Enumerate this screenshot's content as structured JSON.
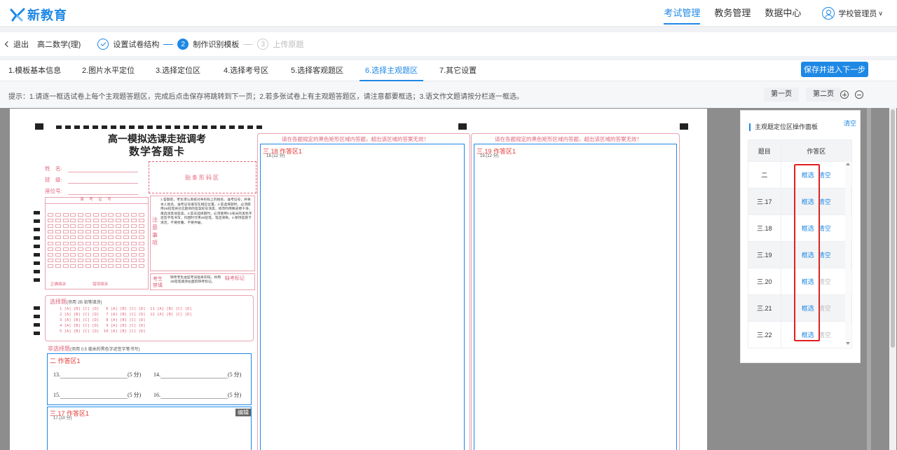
{
  "header": {
    "logo_text": "新教育",
    "nav": [
      "考试管理",
      "教务管理",
      "数据中心"
    ],
    "user": "学校管理员"
  },
  "stepbar": {
    "back": "退出",
    "course": "高二数学(理)",
    "steps": [
      {
        "num": "1",
        "label": "设置试卷结构"
      },
      {
        "num": "2",
        "label": "制作识别模板"
      },
      {
        "num": "3",
        "label": "上传原题"
      }
    ]
  },
  "tabs": [
    "1.模板基本信息",
    "2.图片水平定位",
    "3.选择定位区",
    "4.选择考号区",
    "5.选择客观题区",
    "6.选择主观题区",
    "7.其它设置"
  ],
  "save_button": "保存并进入下一步",
  "tips": "提示：1.请逐一框选试卷上每个主观题答题区，完成后点击保存将跳转到下一页；2.若多张试卷上有主观题答题区，请注意都要框选；3.语文作文题请按分栏逐一框选。",
  "pager": {
    "prev": "第一页",
    "next": "第二页"
  },
  "sheet": {
    "title1": "高一模拟选课走班调考",
    "title2": "数学答题卡",
    "info": [
      "姓　名:",
      "班　级:",
      "座位号:"
    ],
    "barcode": "贴条形码区",
    "exam_no": "准 考 证 号",
    "notice_title": "注意事项",
    "notice_text": "1.答题前，考生须认真核对条形码上的姓名、准考证号，并将本人姓名、准考证号填写在相应位置。2.答选择题时，必须使用2B铅笔将对应题目的答案标号涂黑，修改时用橡皮擦干净，再选涂其他答案。3.答非选择题时，必须使用0.5毫米的黑色字迹签字笔书写，作图时可用2B铅笔，笔迹清晰。4.保持答题卡清洁，不要折叠、不要弄破。",
    "fill_correct": "正确填涂",
    "fill_wrong": "错误填涂",
    "absent_label": "考生禁填",
    "absent_text": "缺考考生由监考员贴条形码，并用2B铅笔填涂右面的缺考标记。",
    "absent_mark": "缺考标记",
    "choice_title": "选择题",
    "choice_note": "(须用 2B 铅笔填涂)",
    "nonchoice_title": "非选择题",
    "nonchoice_note": "(须用 0.5 毫米的黑色字迹签字笔书写)",
    "areas": {
      "a2": "二 作答区1",
      "a17": "三.17 作答区1",
      "a17_sub": "17.(10 分)",
      "a18": "三.18 作答区1",
      "a18_sub": "18.(12 分)",
      "a19": "三.19 作答区1",
      "a19_sub": "19.(12 分)"
    },
    "questions": [
      "13.",
      "(5 分)",
      "14.",
      "(5 分)",
      "15.",
      "(5 分)",
      "16.",
      "(5 分)"
    ],
    "edit": "编辑",
    "warning": "请在各题规定的黑色矩形区域内答题，超出该区域的答案无效！",
    "choice_rows": [
      "1 [A] [B] [C] [D]   6 [A] [B] [C] [D]  11 [A] [B] [C] [D]",
      "2 [A] [B] [C] [D]   7 [A] [B] [C] [D]  12 [A] [B] [C] [D]",
      "3 [A] [B] [C] [D]   8 [A] [B] [C] [D]",
      "4 [A] [B] [C] [D]   9 [A] [B] [C] [D]",
      "5 [A] [B] [C] [D]  10 [A] [B] [C] [D]"
    ]
  },
  "panel": {
    "title": "主观题定位区操作面板",
    "clear_all": "清空",
    "col_question": "题目",
    "col_area": "作答区",
    "rows": [
      {
        "q": "二",
        "select": "框选",
        "clear": "清空",
        "clear_enabled": true
      },
      {
        "q": "三.17",
        "select": "框选",
        "clear": "清空",
        "clear_enabled": true
      },
      {
        "q": "三.18",
        "select": "框选",
        "clear": "清空",
        "clear_enabled": true
      },
      {
        "q": "三.19",
        "select": "框选",
        "clear": "清空",
        "clear_enabled": true
      },
      {
        "q": "三.20",
        "select": "框选",
        "clear": "清空",
        "clear_enabled": false
      },
      {
        "q": "三.21",
        "select": "框选",
        "clear": "清空",
        "clear_enabled": false
      },
      {
        "q": "三.22",
        "select": "框选",
        "clear": "清空",
        "clear_enabled": false
      }
    ]
  },
  "colors": {
    "accent": "#1e88e5",
    "highlight": "#e02020"
  }
}
